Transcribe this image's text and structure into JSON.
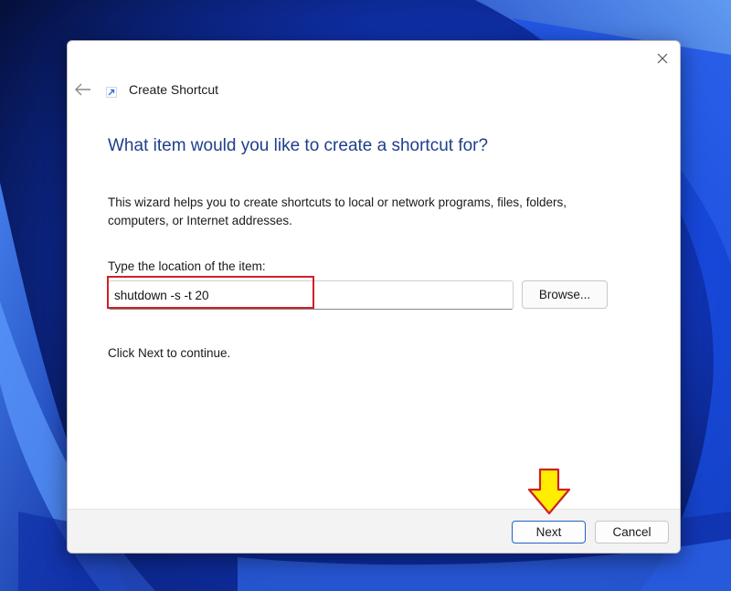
{
  "window": {
    "title": "Create Shortcut"
  },
  "wizard": {
    "heading": "What item would you like to create a shortcut for?",
    "description": "This wizard helps you to create shortcuts to local or network programs, files, folders, computers, or Internet addresses.",
    "location_label": "Type the location of the item:",
    "location_value": "shutdown -s -t 20",
    "browse_label": "Browse...",
    "continue_text": "Click Next to continue."
  },
  "footer": {
    "next_label": "Next",
    "cancel_label": "Cancel"
  },
  "icons": {
    "close": "close-icon",
    "back": "back-arrow-icon",
    "shortcut": "shortcut-arrow-icon"
  },
  "colors": {
    "heading": "#1e3f8a",
    "highlight_box": "#d0202a",
    "annotation_arrow": "#ffee00",
    "next_border": "#1f63c9",
    "wallpaper_blue": "#1340d8"
  }
}
